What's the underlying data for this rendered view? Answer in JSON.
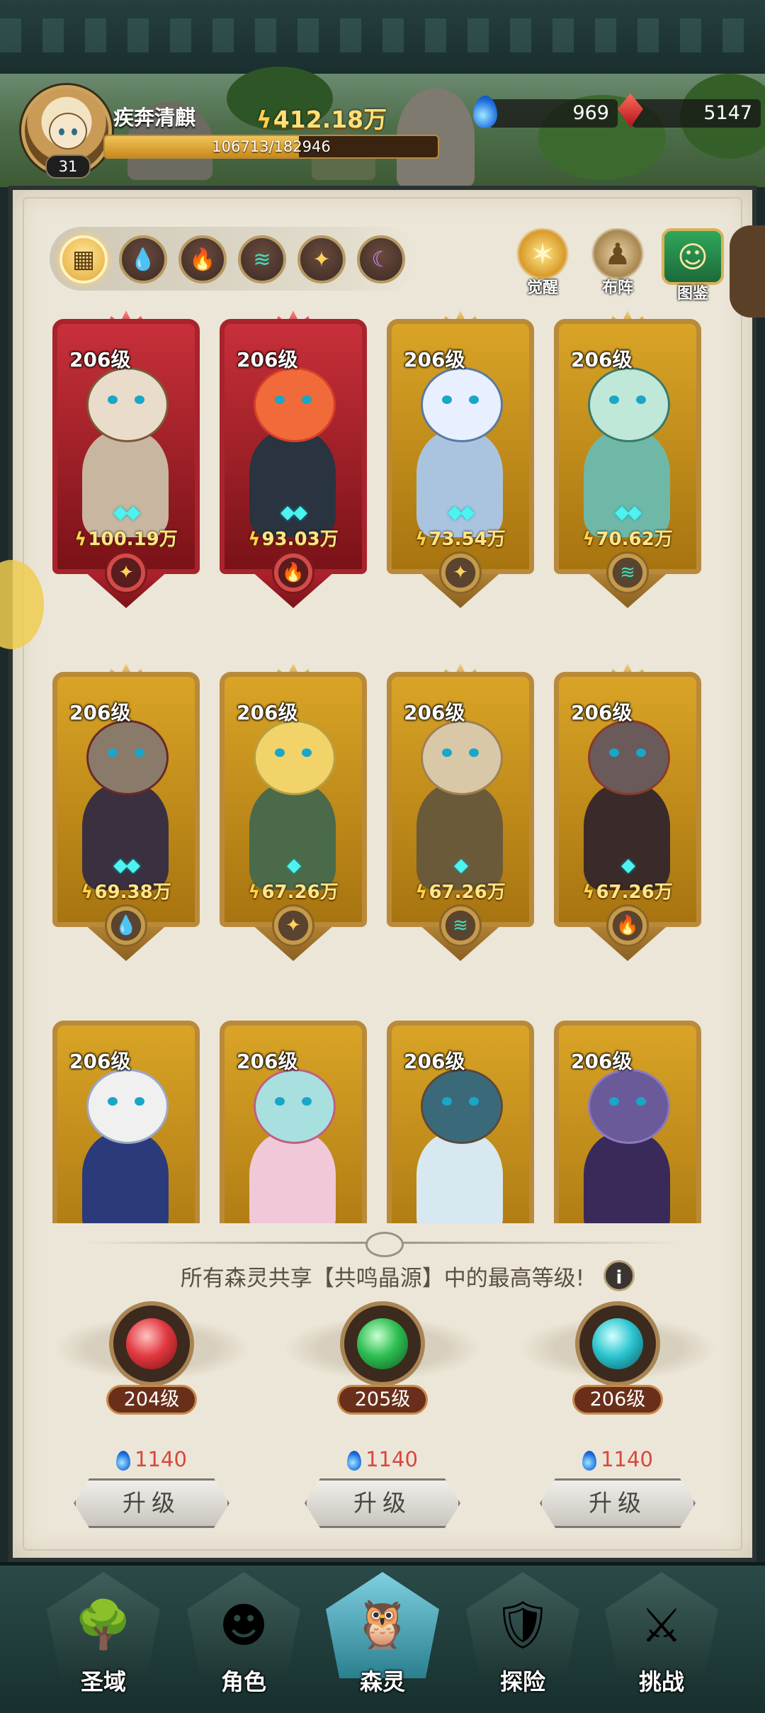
{
  "player": {
    "name": "疾奔清麒",
    "level": "31",
    "exp_text": "106713/182946",
    "exp_fraction": 0.583,
    "power": "412.18万"
  },
  "resources": {
    "water_crystal": "969",
    "ruby": "5147"
  },
  "filter_tabs": [
    {
      "name": "all",
      "icon": "all-grid-icon",
      "active": true
    },
    {
      "name": "water",
      "icon": "water-element-icon"
    },
    {
      "name": "fire",
      "icon": "fire-element-icon"
    },
    {
      "name": "wind",
      "icon": "wind-element-icon"
    },
    {
      "name": "light",
      "icon": "light-element-icon"
    },
    {
      "name": "dark",
      "icon": "moon-element-icon"
    }
  ],
  "side_buttons": {
    "awaken": "觉醒",
    "formation": "布阵",
    "codex": "图鉴"
  },
  "spirits": [
    {
      "level": "206级",
      "power": "100.19万",
      "stars": 2,
      "element": "light",
      "frame": "red"
    },
    {
      "level": "206级",
      "power": "93.03万",
      "stars": 2,
      "element": "fire",
      "frame": "red"
    },
    {
      "level": "206级",
      "power": "73.54万",
      "stars": 2,
      "element": "light",
      "frame": "gold"
    },
    {
      "level": "206级",
      "power": "70.62万",
      "stars": 2,
      "element": "wind",
      "frame": "gold"
    },
    {
      "level": "206级",
      "power": "69.38万",
      "stars": 2,
      "element": "water",
      "frame": "gold"
    },
    {
      "level": "206级",
      "power": "67.26万",
      "stars": 1,
      "element": "light",
      "frame": "gold"
    },
    {
      "level": "206级",
      "power": "67.26万",
      "stars": 1,
      "element": "wind",
      "frame": "gold"
    },
    {
      "level": "206级",
      "power": "67.26万",
      "stars": 1,
      "element": "fire",
      "frame": "gold"
    },
    {
      "level": "206级",
      "frame": "gold"
    },
    {
      "level": "206级",
      "frame": "gold"
    },
    {
      "level": "206级",
      "frame": "gold"
    },
    {
      "level": "206级",
      "frame": "gold"
    }
  ],
  "resonance": {
    "hint": "所有森灵共享【共鸣晶源】中的最高等级!",
    "info_icon": "i",
    "slots": [
      {
        "level": "204级",
        "cost": "1140",
        "button": "升级",
        "color": "#d8383d"
      },
      {
        "level": "205级",
        "cost": "1140",
        "button": "升级",
        "color": "#2fbf52"
      },
      {
        "level": "206级",
        "cost": "1140",
        "button": "升级",
        "color": "#2cc6d0"
      }
    ]
  },
  "bottom_nav": [
    {
      "label": "圣域",
      "icon": "tree-icon",
      "active": false
    },
    {
      "label": "角色",
      "icon": "character-icon",
      "active": false
    },
    {
      "label": "森灵",
      "icon": "spirit-icon",
      "active": true
    },
    {
      "label": "探险",
      "icon": "shield-icon",
      "active": false
    },
    {
      "label": "挑战",
      "icon": "sword-icon",
      "active": false
    }
  ]
}
